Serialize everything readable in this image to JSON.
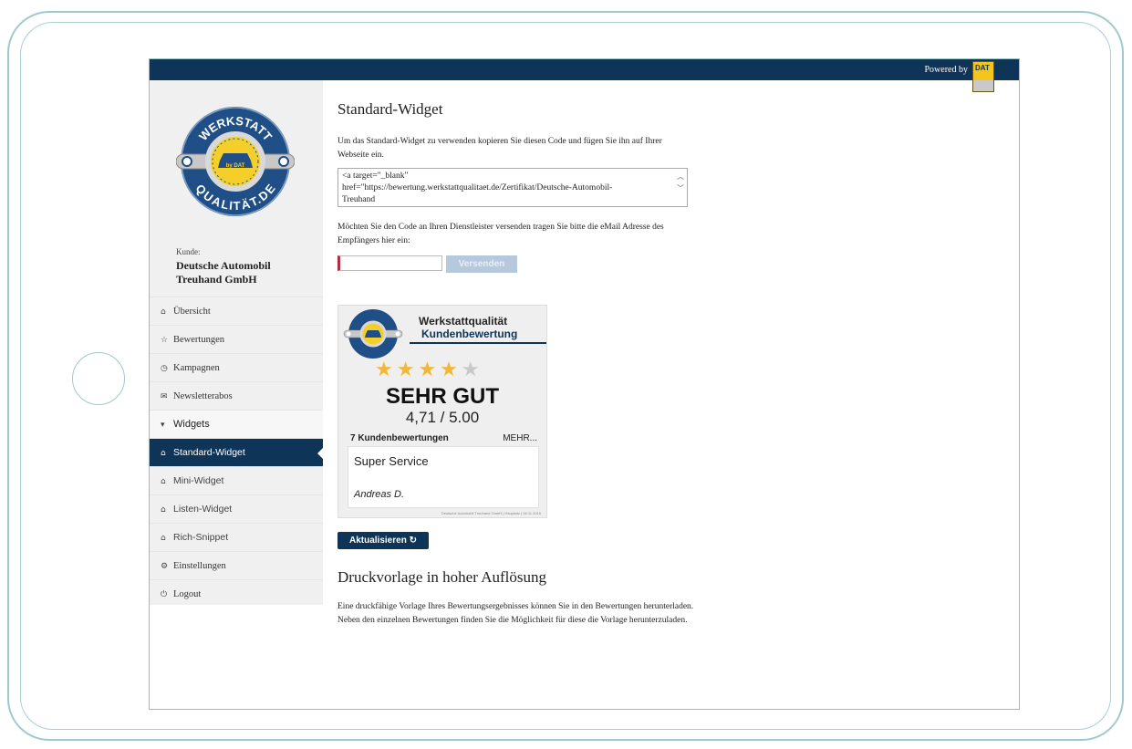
{
  "header": {
    "powered_by": "Powered by",
    "partner_logo": "dat-logo",
    "brand_color": "#0e3458"
  },
  "sidebar": {
    "logo": {
      "top_text": "WERKSTATT",
      "center_text": "by DAT",
      "bottom_text": "QUALITÄT.DE"
    },
    "customer_label": "Kunde:",
    "customer_name": "Deutsche Automobil Treuhand GmbH",
    "nav": [
      {
        "label": "Übersicht",
        "icon": "home-icon"
      },
      {
        "label": "Bewertungen",
        "icon": "star-outline-icon"
      },
      {
        "label": "Kampagnen",
        "icon": "clock-icon"
      },
      {
        "label": "Newsletterabos",
        "icon": "envelope-icon"
      },
      {
        "label": "Widgets",
        "icon": "caret-down-icon"
      },
      {
        "label": "Standard-Widget",
        "icon": "home-icon",
        "active": true
      },
      {
        "label": "Mini-Widget",
        "icon": "home-icon"
      },
      {
        "label": "Listen-Widget",
        "icon": "home-icon"
      },
      {
        "label": "Rich-Snippet",
        "icon": "home-icon"
      },
      {
        "label": "Einstellungen",
        "icon": "gear-icon"
      },
      {
        "label": "Logout",
        "icon": "power-icon"
      }
    ]
  },
  "main": {
    "title": "Standard-Widget",
    "intro": "Um das Standard-Widget zu verwenden kopieren Sie diesen Code und fügen Sie ihn auf Ihrer Webseite ein.",
    "code_line1": "<a target=\"_blank\"",
    "code_line2": "href=\"https://bewertung.werkstattqualitaet.de/Zertifikat/Deutsche-Automobil-",
    "code_line3": "Treuhand",
    "send_text": "Möchten Sie den Code an Ihren Dienstleister versenden tragen Sie bitte die eMail Adresse des Empfängers hier ein:",
    "email_value": "",
    "send_button": "Versenden",
    "widget": {
      "title_line1": "Werkstattqualität",
      "title_line2": "Kundenbewertung",
      "stars": "★★★★",
      "half_star": "★",
      "rating": 4.71,
      "verdict": "SEHR GUT",
      "score": "4,71 / 5.00",
      "count": "7 Kundenbewertungen",
      "more": "MEHR...",
      "review_text": "Super Service",
      "review_author": "Andreas D.",
      "footer": "Deutsche Automobil Treuhand GmbH | Hauptsitz | 26.11.2015"
    },
    "update_button": "Aktualisieren",
    "print_title": "Druckvorlage in hoher Auflösung",
    "print_text": "Eine druckfähige Vorlage Ihres Bewertungsergebnisses können Sie in den Bewertungen herunterladen. Neben den einzelnen Bewertungen finden Sie die Möglichkeit für diese die Vorlage herunterzuladen."
  }
}
